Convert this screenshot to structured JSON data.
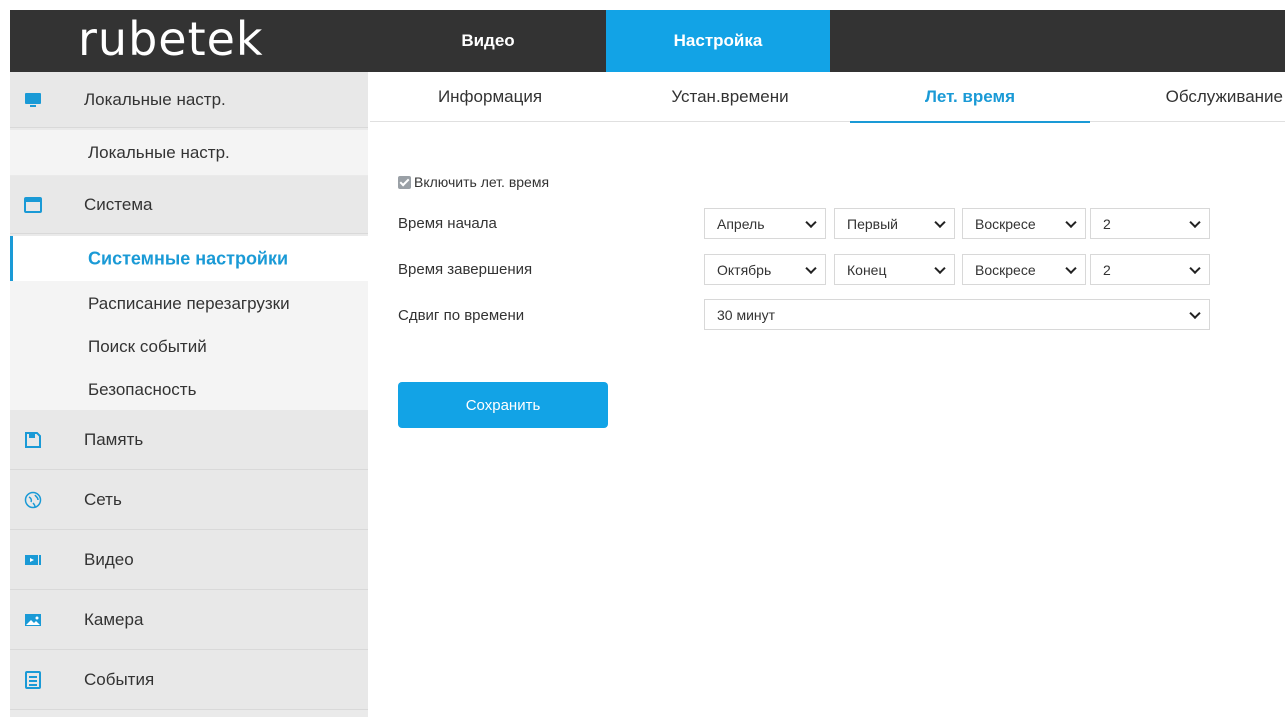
{
  "brand": {
    "logo": "rubetek"
  },
  "topnav": {
    "video": "Видео",
    "settings": "Настройка"
  },
  "sidebar": {
    "local": {
      "label": "Локальные настр.",
      "icon": "monitor-icon"
    },
    "local_sub": "Локальные настр.",
    "system": {
      "label": "Система",
      "icon": "window-icon"
    },
    "system_sub": [
      "Системные настройки",
      "Расписание перезагрузки",
      "Поиск событий",
      "Безопасность"
    ],
    "storage": {
      "label": "Память",
      "icon": "floppy-icon"
    },
    "network": {
      "label": "Сеть",
      "icon": "globe-icon"
    },
    "video": {
      "label": "Видео",
      "icon": "video-icon"
    },
    "camera": {
      "label": "Камера",
      "icon": "image-icon"
    },
    "events": {
      "label": "События",
      "icon": "list-icon"
    }
  },
  "subtabs": [
    "Информация",
    "Устан.времени",
    "Лет. время",
    "Обслуживание"
  ],
  "form": {
    "enable_dst": "Включить лет. время",
    "start_label": "Время начала",
    "end_label": "Время завершения",
    "offset_label": "Сдвиг по времени",
    "start": {
      "month": "Апрель",
      "week": "Первый",
      "day": "Воскресе",
      "hour": "2"
    },
    "end": {
      "month": "Октябрь",
      "week": "Конец",
      "day": "Воскресе",
      "hour": "2"
    },
    "offset": "30 минут",
    "save": "Сохранить"
  },
  "colors": {
    "accent": "#12a3e6",
    "topbar": "#333333",
    "sidebar": "#e8e8e8"
  }
}
